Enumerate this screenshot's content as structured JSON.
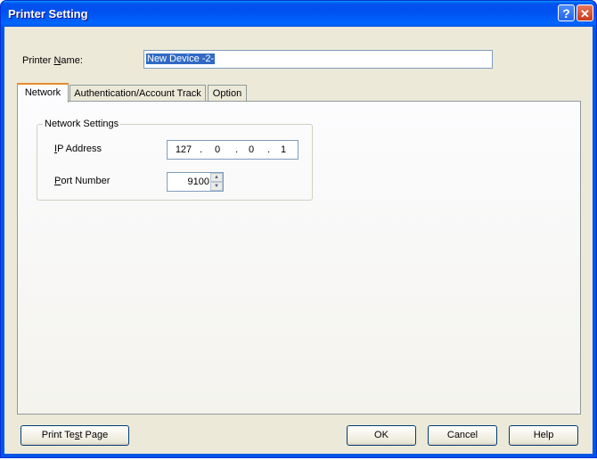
{
  "window": {
    "title": "Printer Setting",
    "help_glyph": "?",
    "close_glyph": "✕"
  },
  "printer_name": {
    "label_pre": "Printer ",
    "label_u": "N",
    "label_post": "ame:",
    "value": "New Device -2-"
  },
  "tabs": [
    {
      "label": "Network",
      "active": true
    },
    {
      "label": "Authentication/Account Track",
      "active": false
    },
    {
      "label": "Option",
      "active": false
    }
  ],
  "network_settings": {
    "group_title": "Network Settings",
    "ip_label_u": "I",
    "ip_label_post": "P Address",
    "ip_octets": [
      "127",
      "0",
      "0",
      "1"
    ],
    "dot": ".",
    "port_label_u": "P",
    "port_label_post": "ort Number",
    "port_value": "9100",
    "spin_up": "▲",
    "spin_down": "▼"
  },
  "buttons": {
    "print_test_pre": "Print Te",
    "print_test_u": "s",
    "print_test_post": "t Page",
    "ok": "OK",
    "cancel": "Cancel",
    "help": "Help"
  },
  "colors": {
    "titlebar": "#0054e3",
    "face": "#ece9d8",
    "selection": "#316ac5",
    "active_tab_accent": "#e68b2c"
  }
}
